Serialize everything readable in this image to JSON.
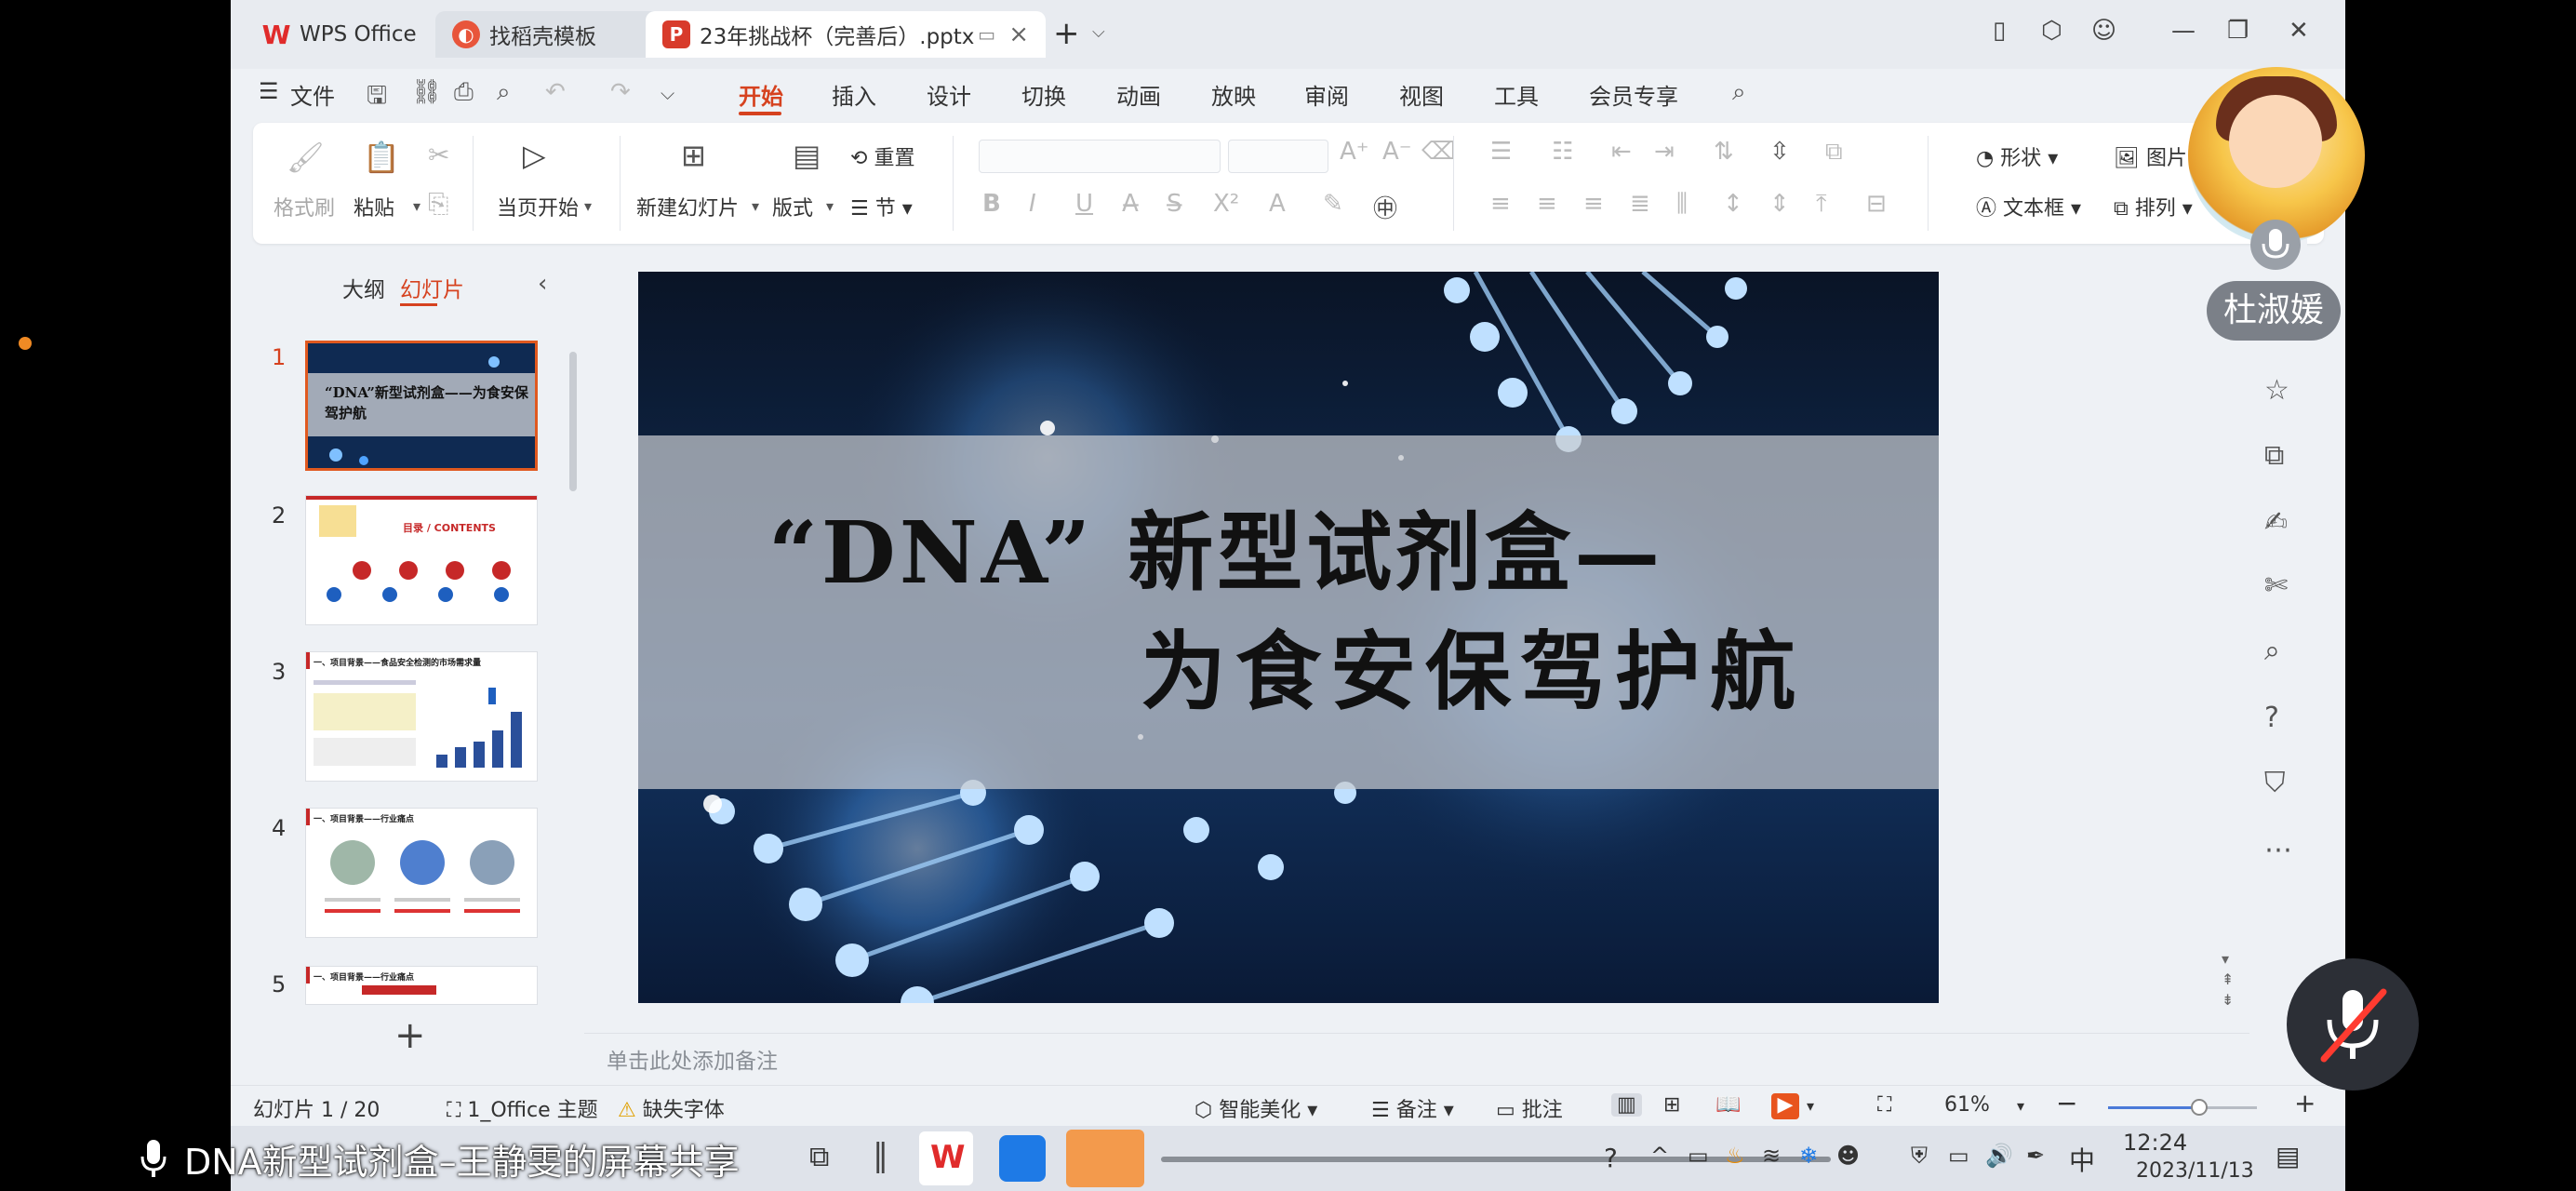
{
  "titlebar": {
    "tabs": [
      {
        "label": "WPS Office",
        "icon": "wps-logo-icon"
      },
      {
        "label": "找稻壳模板",
        "icon": "docer-icon"
      },
      {
        "label": "23年挑战杯（完善后）.pptx",
        "icon": "ppt-file-icon"
      }
    ],
    "add_tab": "+"
  },
  "menubar": {
    "file_label": "文件",
    "items": [
      "开始",
      "插入",
      "设计",
      "切换",
      "动画",
      "放映",
      "审阅",
      "视图",
      "工具",
      "会员专享"
    ],
    "active": "开始"
  },
  "ribbon": {
    "format_painter": "格式刷",
    "paste": "粘贴",
    "play_from_current": "当页开始",
    "new_slide": "新建幻灯片",
    "layout": "版式",
    "reset": "重置",
    "section": "节",
    "shape": "形状",
    "picture": "图片",
    "textbox": "文本框",
    "arrange": "排列"
  },
  "slidepanel": {
    "tab_outline": "大纲",
    "tab_slides": "幻灯片",
    "slide_numbers": [
      "1",
      "2",
      "3",
      "4",
      "5"
    ],
    "thumb1_title": "“DNA”新型试剂盒——为食安保驾护航",
    "thumb2_title": "目录 / CONTENTS",
    "thumb3_title": "一、项目背景——食品安全检测的市场需求量",
    "thumb4_title": "一、项目背景——行业痛点",
    "thumb5_title": "一、项目背景——行业痛点",
    "add_slide": "+"
  },
  "slide": {
    "title_line1": "“DNA” 新型试剂盒—",
    "title_line2": "为食安保驾护航"
  },
  "notes": {
    "placeholder": "单击此处添加备注"
  },
  "statusbar": {
    "slide_count": "幻灯片 1 / 20",
    "theme": "1_Office 主题",
    "missing_font": "缺失字体",
    "smart_beautify": "智能美化",
    "notes": "备注",
    "comments": "批注",
    "zoom": "61%",
    "zoom_fraction": 0.61
  },
  "taskbar": {
    "ime": "中",
    "time": "12:24",
    "date": "2023/11/13"
  },
  "overlay": {
    "share_text": "DNA新型试剂盒–王静雯的屏幕共享",
    "participant_name": "杜淑媛"
  },
  "colors": {
    "accent": "#d6421f",
    "ppt_red": "#d83b2b",
    "slide_bg": "#0b1a33",
    "dna_blue": "#4fa3ff"
  }
}
